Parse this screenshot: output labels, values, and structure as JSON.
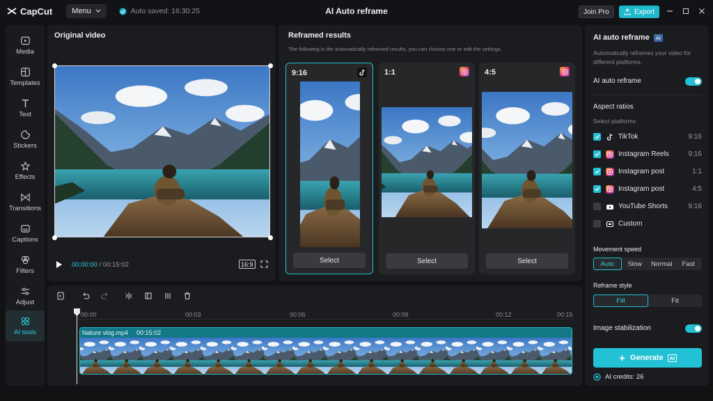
{
  "titlebar": {
    "app_name": "CapCut",
    "menu_label": "Menu",
    "autosave": "Auto saved: 16:30:25",
    "title": "AI Auto reframe",
    "join_pro": "Join Pro",
    "export": "Export"
  },
  "nav": {
    "items": [
      {
        "label": "Media",
        "icon": "media-icon"
      },
      {
        "label": "Templates",
        "icon": "templates-icon"
      },
      {
        "label": "Text",
        "icon": "text-icon"
      },
      {
        "label": "Stickers",
        "icon": "stickers-icon"
      },
      {
        "label": "Effects",
        "icon": "effects-icon"
      },
      {
        "label": "Transitions",
        "icon": "transitions-icon"
      },
      {
        "label": "Captions",
        "icon": "captions-icon"
      },
      {
        "label": "Filters",
        "icon": "filters-icon"
      },
      {
        "label": "Adjust",
        "icon": "adjust-icon"
      },
      {
        "label": "AI tools",
        "icon": "ai-tools-icon"
      }
    ]
  },
  "original": {
    "title": "Original video",
    "current_time": "00:00:00",
    "separator": " / ",
    "total_time": "00:15:02",
    "ratio_badge": "16:9"
  },
  "results": {
    "title": "Reframed results",
    "subtitle": "The following is the automatically reframed results, you can choose one or edit the settings.",
    "cards": [
      {
        "ratio": "9:16",
        "icon": "tiktok-icon",
        "select": "Select"
      },
      {
        "ratio": "1:1",
        "icon": "instagram-icon",
        "select": "Select"
      },
      {
        "ratio": "4:5",
        "icon": "instagram-icon",
        "select": "Select"
      }
    ]
  },
  "right": {
    "header": "AI auto reframe",
    "ai_badge": "AI",
    "desc": "Automatically reframes your video for different platforms.",
    "toggle_label": "AI auto reframe",
    "aspect_title": "Aspect ratios",
    "select_platforms": "Select platforms",
    "platforms": [
      {
        "name": "TikTok",
        "ratio": "9:16",
        "checked": true,
        "icon": "tiktok-icon"
      },
      {
        "name": "Instagram Reels",
        "ratio": "9:16",
        "checked": true,
        "icon": "instagram-icon"
      },
      {
        "name": "Instagram post",
        "ratio": "1:1",
        "checked": true,
        "icon": "instagram-icon"
      },
      {
        "name": "Instagram post",
        "ratio": "4:5",
        "checked": true,
        "icon": "instagram-icon"
      },
      {
        "name": "YouTube Shorts",
        "ratio": "9:16",
        "checked": false,
        "icon": "youtube-icon"
      },
      {
        "name": "Custom",
        "ratio": "",
        "checked": false,
        "icon": "custom-icon"
      }
    ],
    "movement_title": "Movement speed",
    "movement_options": [
      "Auto",
      "Slow",
      "Normal",
      "Fast"
    ],
    "style_title": "Reframe style",
    "style_options": [
      "Fill",
      "Fit"
    ],
    "stabilization_label": "Image stabilization",
    "generate_label": "Generate",
    "credits": "AI credits: 26"
  },
  "timeline": {
    "ruler": [
      "00:00",
      "00:03",
      "00:06",
      "00:09",
      "00:12",
      "00:15"
    ],
    "clip_name": "Nature vlog.mp4",
    "clip_duration": "00:15:02"
  },
  "colors": {
    "accent": "#22c1d4",
    "background": "#111214",
    "panel": "#1b1c1f"
  }
}
